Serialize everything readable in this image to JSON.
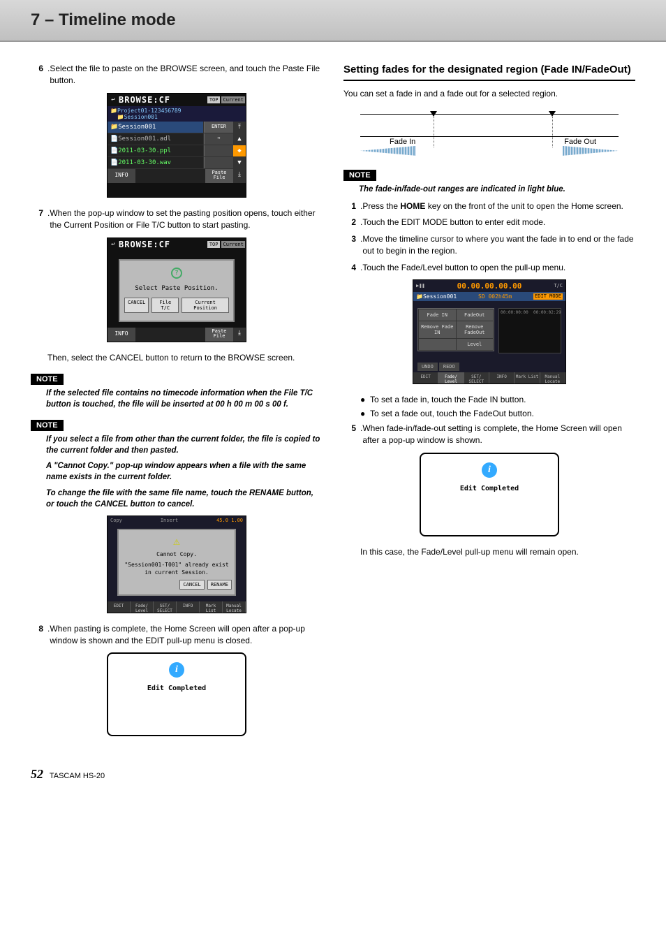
{
  "header": {
    "title": "7 – Timeline mode"
  },
  "left": {
    "step6": {
      "num": "6",
      "text_a": "Select the file to paste on the BROWSE screen, and touch the ",
      "text_b": "Paste File",
      "text_c": " button."
    },
    "browse1": {
      "title": "BROWSE:CF",
      "top": "TOP",
      "current": "Current",
      "path1": "Project01-123456789",
      "path2": "Session001",
      "row1": "Session001",
      "enter": "ENTER",
      "row2": "Session001.adl",
      "row3": "2011-03-30.ppl",
      "row4": "2011-03-30.wav",
      "info": "INFO",
      "paste": "Paste\nFile"
    },
    "step7": {
      "num": "7",
      "text": "When the pop-up window to set the pasting position opens, touch either the Current Position or File T/C button to start pasting."
    },
    "paste_dialog": {
      "title": "BROWSE:CF",
      "top": "TOP",
      "current": "Current",
      "msg": "Select Paste Position.",
      "cancel": "CANCEL",
      "filetc": "File T/C",
      "curpos": "Current\nPosition",
      "info": "INFO",
      "paste": "Paste\nFile"
    },
    "after7": "Then, select the CANCEL button to return to the BROWSE screen.",
    "note1_label": "NOTE",
    "note1": "If the selected file contains no timecode information when the File T/C button is touched, the file will be inserted at 00 h 00 m 00 s 00 f.",
    "note2_label": "NOTE",
    "note2a": "If you select a file from other than the current folder, the file is copied to the current folder and then pasted.",
    "note2b": "A \"Cannot Copy.\" pop-up window appears when a file with the same name exists in the current folder.",
    "note2c": "To change the file with the same file name, touch the RENAME button, or touch the CANCEL button to cancel.",
    "cannot": {
      "copy": "Copy",
      "insert": "Insert",
      "msg1": "Cannot Copy.",
      "msg2": "\"Session001-T001\"\nalready exist in current Session.",
      "cancel": "CANCEL",
      "rename": "RENAME",
      "tabs": [
        "EDIT",
        "Fade/\nLevel",
        "SET/\nSELECT",
        "INFO",
        "Mark\nList",
        "Manual\nLocate"
      ]
    },
    "step8": {
      "num": "8",
      "text": "When pasting is complete, the Home Screen will open after a pop-up window is shown and the EDIT pull-up menu is closed."
    },
    "popup1": "Edit Completed"
  },
  "right": {
    "h2": "Setting fades for the designated region (Fade IN/FadeOut)",
    "intro": "You can set a fade in and a fade out for a selected region.",
    "diagram": {
      "fadein": "Fade In",
      "fadeout": "Fade Out"
    },
    "note_label": "NOTE",
    "note": "The fade-in/fade-out ranges are indicated in light blue.",
    "step1": {
      "num": "1",
      "a": "Press the ",
      "b": "HOME",
      "c": " key on the front of the unit to open the Home screen."
    },
    "step2": {
      "num": "2",
      "text": "Touch the EDIT MODE button to enter edit mode."
    },
    "step3": {
      "num": "3",
      "text": "Move the timeline cursor to where you want the fade in to end or the fade out to begin in the region."
    },
    "step4": {
      "num": "4",
      "text": "Touch the Fade/Level button to open the pull-up menu."
    },
    "fade_screen": {
      "tc": "00.00.00.00.00",
      "tc_sub": "T/C",
      "session": "Session001",
      "sd": "SD",
      "time": "002h45m",
      "edit": "EDIT\nMODE",
      "btns": [
        "Fade IN",
        "FadeOut",
        "Remove\nFade IN",
        "Remove\nFadeOut",
        "",
        "Level"
      ],
      "t1": "00:00:00:00",
      "t2": "00:00:02:29",
      "undo": "UNDO",
      "redo": "REDO",
      "tabs": [
        "EDIT",
        "Fade/\nLevel",
        "SET/\nSELECT",
        "INFO",
        "Mark\nList",
        "Manual\nLocate"
      ]
    },
    "bullet1": "To set a fade in, touch the Fade IN button.",
    "bullet2": "To set a fade out, touch the FadeOut button.",
    "step5": {
      "num": "5",
      "text": "When fade-in/fade-out setting is complete, the Home Screen will open after a pop-up window is shown."
    },
    "popup2": "Edit Completed",
    "after5": "In this case, the Fade/Level pull-up menu will remain open."
  },
  "footer": {
    "page": "52",
    "model": "TASCAM HS-20"
  }
}
